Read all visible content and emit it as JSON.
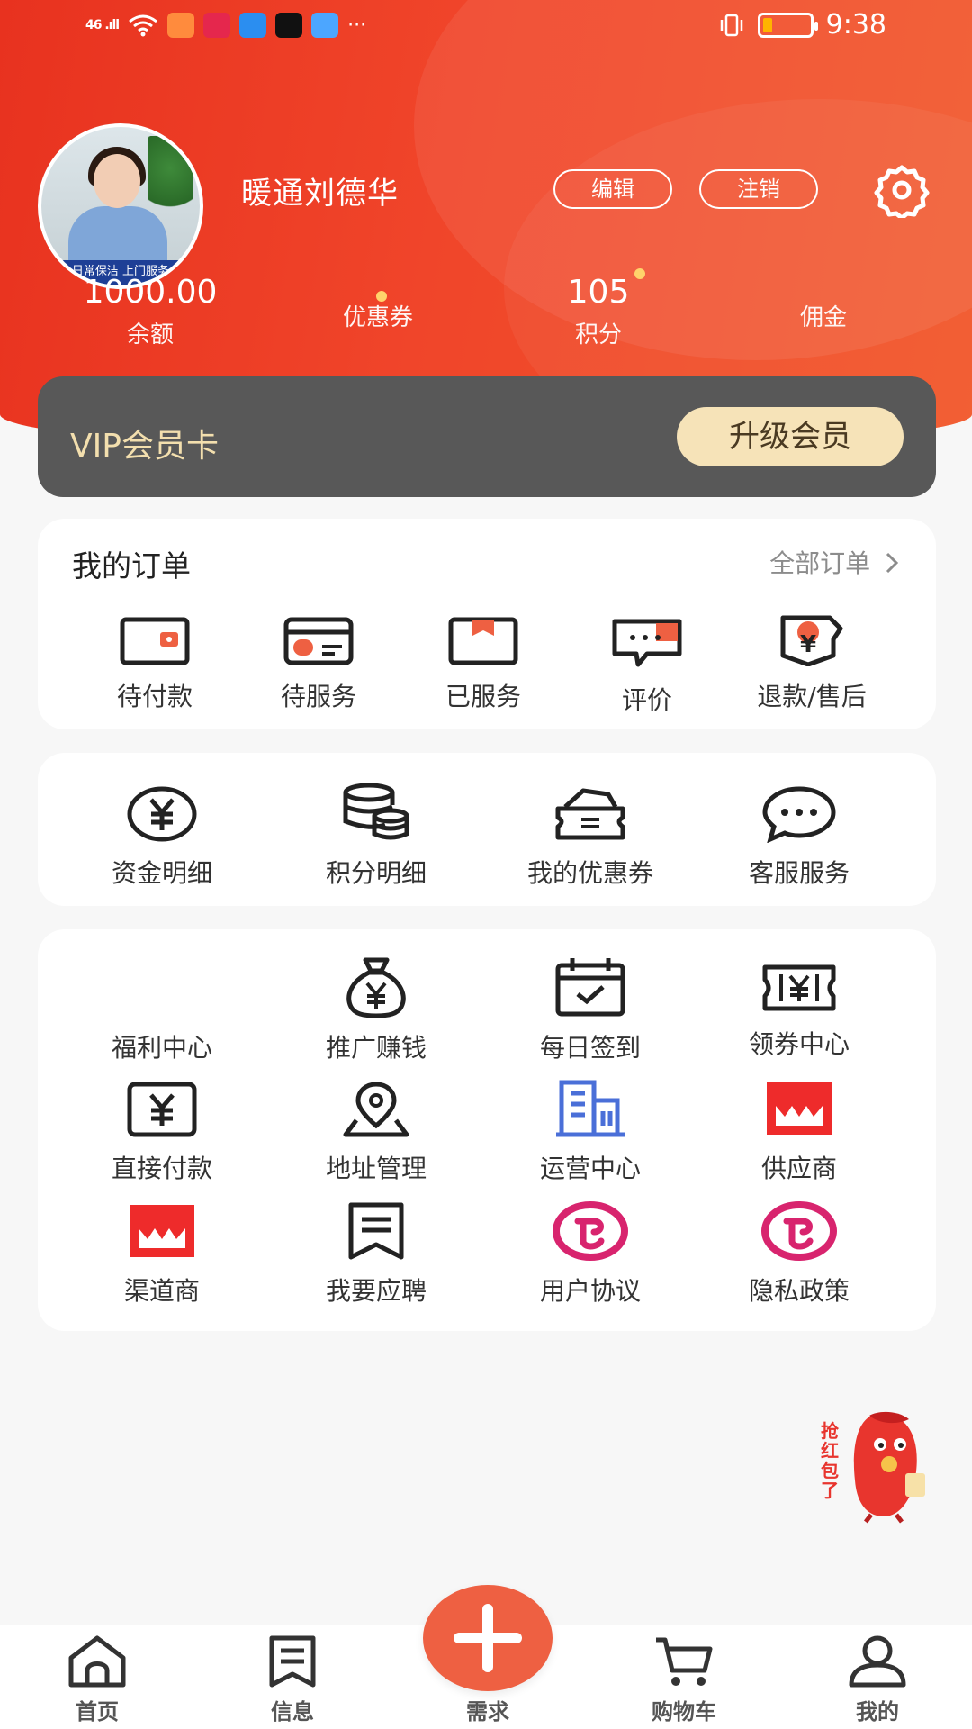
{
  "status_bar": {
    "signal": "46 .ıll",
    "time": "9:38",
    "more": "···"
  },
  "profile": {
    "username": "暖通刘德华",
    "edit_label": "编辑",
    "logout_label": "注销",
    "avatar_banner": "日常保洁 上门服务"
  },
  "stats": {
    "balance_value": "1000.00",
    "balance_label": "余额",
    "coupon_label": "优惠券",
    "points_value": "105",
    "points_label": "积分",
    "commission_label": "佣金"
  },
  "vip": {
    "title": "VIP会员卡",
    "upgrade_label": "升级会员"
  },
  "orders": {
    "title": "我的订单",
    "all_label": "全部订单",
    "items": [
      {
        "label": "待付款",
        "icon": "wallet-icon"
      },
      {
        "label": "待服务",
        "icon": "card-icon"
      },
      {
        "label": "已服务",
        "icon": "box-icon"
      },
      {
        "label": "评价",
        "icon": "comment-icon"
      },
      {
        "label": "退款/售后",
        "icon": "refund-icon"
      }
    ]
  },
  "functions": {
    "items": [
      {
        "label": "资金明细",
        "icon": "yuan-circle-icon"
      },
      {
        "label": "积分明细",
        "icon": "coins-stack-icon"
      },
      {
        "label": "我的优惠券",
        "icon": "coupon-wallet-icon"
      },
      {
        "label": "客服服务",
        "icon": "chat-bubble-icon"
      }
    ]
  },
  "tools": {
    "items": [
      {
        "label": "福利中心",
        "icon": "none"
      },
      {
        "label": "推广赚钱",
        "icon": "money-bag-icon"
      },
      {
        "label": "每日签到",
        "icon": "calendar-check-icon"
      },
      {
        "label": "领券中心",
        "icon": "ticket-icon"
      },
      {
        "label": "直接付款",
        "icon": "yuan-square-icon"
      },
      {
        "label": "地址管理",
        "icon": "location-pin-icon"
      },
      {
        "label": "运营中心",
        "icon": "building-icon"
      },
      {
        "label": "供应商",
        "icon": "store-icon"
      },
      {
        "label": "渠道商",
        "icon": "store-icon"
      },
      {
        "label": "我要应聘",
        "icon": "bookmark-doc-icon"
      },
      {
        "label": "用户协议",
        "icon": "agreement-icon"
      },
      {
        "label": "隐私政策",
        "icon": "agreement-icon"
      }
    ]
  },
  "floating": {
    "text": "抢红包了"
  },
  "tabbar": {
    "items": [
      {
        "label": "首页",
        "icon": "home-icon"
      },
      {
        "label": "信息",
        "icon": "message-doc-icon"
      },
      {
        "label": "需求",
        "icon": "plus-icon"
      },
      {
        "label": "购物车",
        "icon": "cart-icon"
      },
      {
        "label": "我的",
        "icon": "user-icon"
      }
    ]
  },
  "colors": {
    "header": "#ee3d24",
    "accent": "#ee6042",
    "vip_card": "#585858",
    "vip_text": "#f3dfae",
    "store_red": "#ee2b2b",
    "agreement_pink": "#d8246e",
    "building_blue": "#4a6fd8"
  }
}
